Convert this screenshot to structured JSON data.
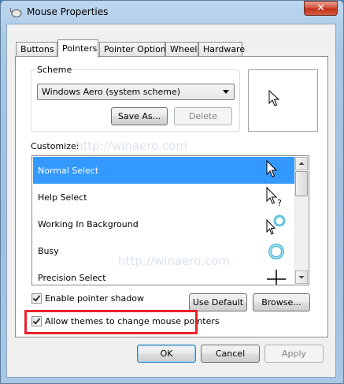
{
  "window": {
    "title": "Mouse Properties",
    "close_glyph": "✕"
  },
  "tabs": [
    {
      "label": "Buttons",
      "active": false
    },
    {
      "label": "Pointers",
      "active": true
    },
    {
      "label": "Pointer Options",
      "active": false
    },
    {
      "label": "Wheel",
      "active": false
    },
    {
      "label": "Hardware",
      "active": false
    }
  ],
  "scheme": {
    "group_label": "Scheme",
    "selected_value": "Windows Aero (system scheme)",
    "save_as_label": "Save As...",
    "delete_label": "Delete"
  },
  "customize": {
    "label": "Customize:",
    "rows": [
      {
        "label": "Normal Select",
        "cursor": "arrow-cursor-icon",
        "selected": true
      },
      {
        "label": "Help Select",
        "cursor": "help-cursor-icon",
        "selected": false
      },
      {
        "label": "Working In Background",
        "cursor": "working-cursor-icon",
        "selected": false
      },
      {
        "label": "Busy",
        "cursor": "busy-cursor-icon",
        "selected": false
      },
      {
        "label": "Precision Select",
        "cursor": "crosshair-cursor-icon",
        "selected": false
      }
    ]
  },
  "options": {
    "enable_shadow_label": "Enable pointer shadow",
    "enable_shadow_checked": true,
    "allow_themes_label": "Allow themes to change mouse pointers",
    "allow_themes_checked": true,
    "use_default_label": "Use Default",
    "browse_label": "Browse..."
  },
  "footer": {
    "ok_label": "OK",
    "cancel_label": "Cancel",
    "apply_label": "Apply"
  },
  "watermark": "http://winaero.com",
  "colors": {
    "selection": "#3399ff",
    "highlight_box": "#e8222c",
    "close_button": "#c74a33"
  }
}
